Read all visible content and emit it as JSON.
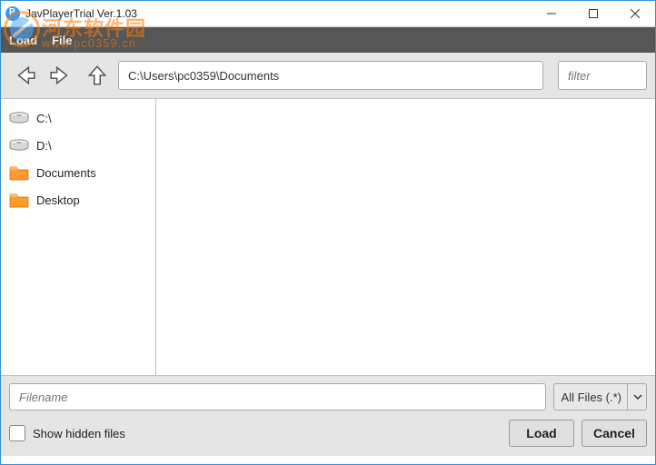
{
  "window": {
    "title": "JavPlayerTrial Ver.1.03"
  },
  "watermark": {
    "text1": "河东软件园",
    "text2": "www.pc0359.cn"
  },
  "header": {
    "item1": "Load",
    "item2": "File"
  },
  "toolbar": {
    "path": "C:\\Users\\pc0359\\Documents",
    "filter_placeholder": "filter"
  },
  "sidebar": {
    "items": [
      {
        "label": "C:\\",
        "type": "drive"
      },
      {
        "label": "D:\\",
        "type": "drive"
      },
      {
        "label": "Documents",
        "type": "folder"
      },
      {
        "label": "Desktop",
        "type": "folder"
      }
    ]
  },
  "bottom": {
    "filename_placeholder": "Filename",
    "filetype_label": "All Files (.*)",
    "show_hidden_label": "Show hidden files",
    "load_label": "Load",
    "cancel_label": "Cancel"
  }
}
